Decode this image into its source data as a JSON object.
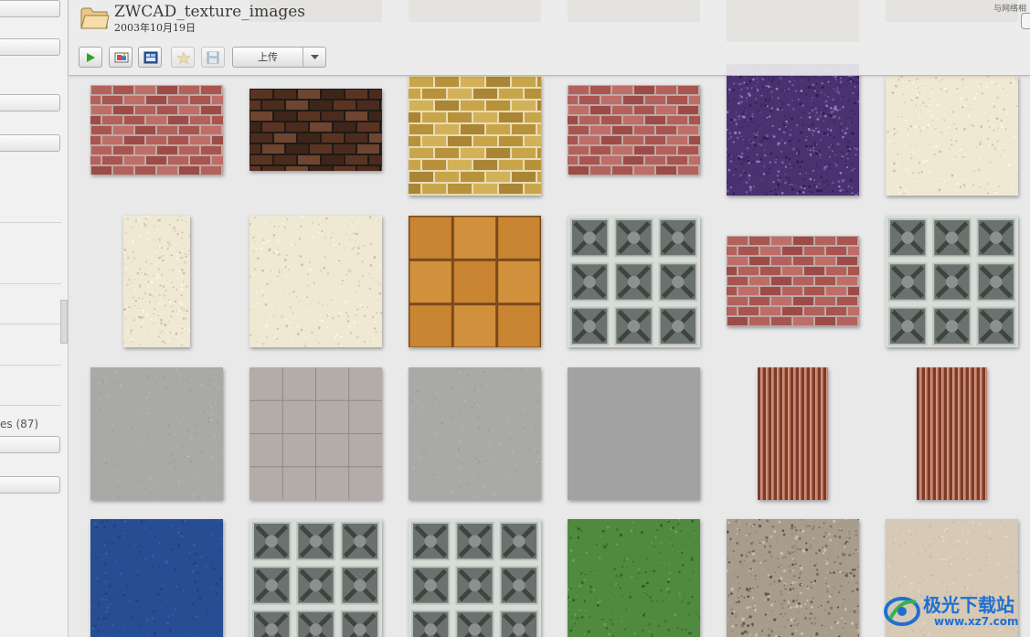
{
  "folder": {
    "title": "ZWCAD_texture_images",
    "date": "2003年10月19日"
  },
  "toolbar": {
    "upload_label": "上传",
    "net_label": "与网络相"
  },
  "left_panel": {
    "partial_label": "es (87)"
  },
  "icons": {
    "folder": "folder-icon",
    "play": "play-icon",
    "slideshow": "slideshow-icon",
    "collage": "collage-icon",
    "star": "star-icon",
    "save": "save-icon",
    "dropdown": "chevron-down-icon"
  },
  "thumbnails": [
    {
      "texture": "red-brick"
    },
    {
      "texture": "dark-brick"
    },
    {
      "texture": "yellow-brick"
    },
    {
      "texture": "red-brick"
    },
    {
      "texture": "purple-granite"
    },
    {
      "texture": "beige-stucco"
    },
    {
      "texture": "beige-stucco"
    },
    {
      "texture": "beige-stucco"
    },
    {
      "texture": "orange-tile"
    },
    {
      "texture": "glass-block"
    },
    {
      "texture": "red-brick"
    },
    {
      "texture": "glass-block"
    },
    {
      "texture": "grey-concrete"
    },
    {
      "texture": "grey-tile"
    },
    {
      "texture": "grey-concrete"
    },
    {
      "texture": "grey-flat"
    },
    {
      "texture": "copper-ribbed"
    },
    {
      "texture": "copper-ribbed"
    },
    {
      "texture": "blue-fabric"
    },
    {
      "texture": "glass-block"
    },
    {
      "texture": "glass-block"
    },
    {
      "texture": "green-grass"
    },
    {
      "texture": "gravel"
    },
    {
      "texture": "beige-fabric"
    }
  ],
  "watermark": {
    "brand": "极光下载站",
    "url": "www.xz7.com"
  },
  "colors": {
    "accent_green": "#2aa52a",
    "watermark_blue": "#1f6fd1"
  }
}
